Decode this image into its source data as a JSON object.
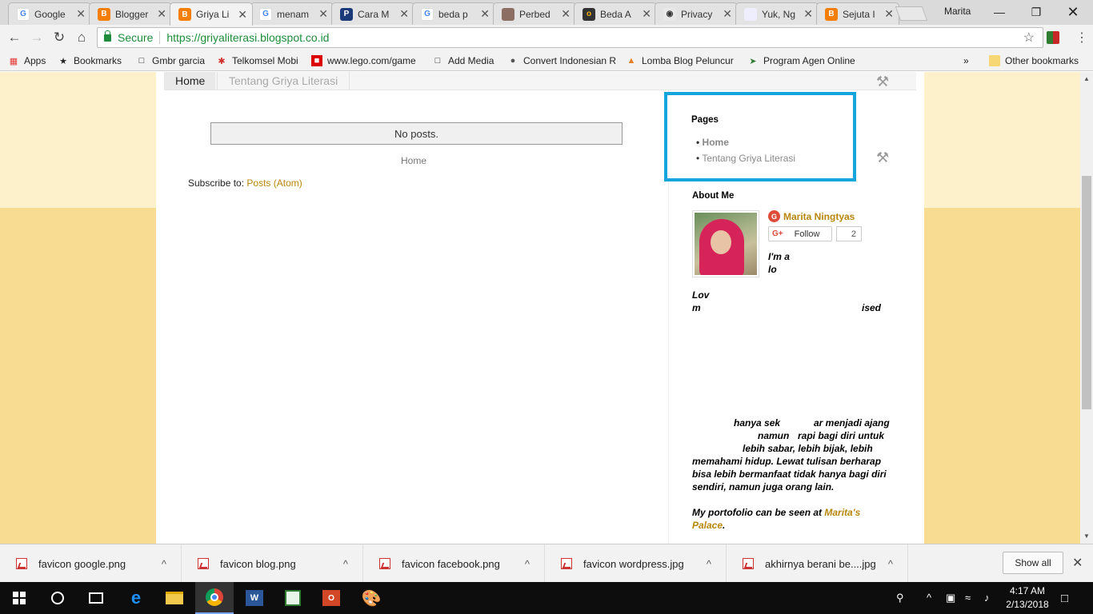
{
  "browser": {
    "user": "Marita",
    "tabs": [
      {
        "title": "Google",
        "icon": "google-icon",
        "active": false
      },
      {
        "title": "Blogger",
        "icon": "blogger-icon",
        "active": false
      },
      {
        "title": "Griya Li",
        "icon": "blogger-icon",
        "active": true
      },
      {
        "title": "menam",
        "icon": "google-icon",
        "active": false
      },
      {
        "title": "Cara M",
        "icon": "parking-icon",
        "active": false
      },
      {
        "title": "beda p",
        "icon": "google-icon",
        "active": false
      },
      {
        "title": "Perbed",
        "icon": "photo-icon",
        "active": false
      },
      {
        "title": "Beda A",
        "icon": "ring-icon",
        "active": false
      },
      {
        "title": "Privacy",
        "icon": "eye-icon",
        "active": false
      },
      {
        "title": "Yuk, Ng",
        "icon": "page-icon",
        "active": false
      },
      {
        "title": "Sejuta I",
        "icon": "blogger-icon",
        "active": false
      }
    ],
    "secure_label": "Secure",
    "url": "https://griyaliterasi.blogspot.co.id",
    "bookmarks": [
      {
        "label": "Apps",
        "icon": "apps-grid-icon"
      },
      {
        "label": "Bookmarks",
        "icon": "star-icon"
      },
      {
        "label": "Gmbr garcia",
        "icon": "page-icon"
      },
      {
        "label": "Telkomsel Mobi",
        "icon": "telkomsel-icon"
      },
      {
        "label": "www.lego.com/game",
        "icon": "lego-icon"
      },
      {
        "label": "Add Media",
        "icon": "page-icon"
      },
      {
        "label": "Convert Indonesian R",
        "icon": "convert-icon"
      },
      {
        "label": "Lomba Blog Peluncur",
        "icon": "triangle-icon"
      },
      {
        "label": "Program Agen Online",
        "icon": "agen-icon"
      }
    ],
    "overflow_label": "»",
    "other_bookmarks": "Other bookmarks"
  },
  "blog": {
    "nav": [
      "Home",
      "Tentang Griya Literasi"
    ],
    "no_posts": "No posts.",
    "home_link": "Home",
    "subscribe_prefix": "Subscribe to:",
    "subscribe_link": "Posts (Atom)",
    "pages_widget": {
      "title": "Pages",
      "items": [
        "Home",
        "Tentang Griya Literasi"
      ]
    },
    "about": {
      "title": "About Me",
      "name": "Marita Ningtyas",
      "follow": "Follow",
      "follow_count": "2",
      "bio_lines_1": [
        "I'm a",
        "lo",
        "Lov",
        "m",
        "ised"
      ],
      "bio_lines_2": [
        "hanya sek",
        "ar menjadi ajang",
        "namun",
        "rapi bagi diri untuk",
        "lebih sabar, lebih bijak, lebih",
        "memahami hidup. Lewat tulisan berharap",
        "bisa lebih bermanfaat tidak hanya bagi diri",
        "sendiri, namun juga orang lain."
      ],
      "portfolio_prefix": "My portofolio can be seen at",
      "portfolio_link": "Marita's Palace"
    }
  },
  "downloads": {
    "items": [
      "favicon google.png",
      "favicon blog.png",
      "favicon facebook.png",
      "favicon wordpress.jpg",
      "akhirnya berani be....jpg"
    ],
    "show_all": "Show all"
  },
  "taskbar": {
    "time": "4:17 AM",
    "date": "2/13/2018"
  }
}
